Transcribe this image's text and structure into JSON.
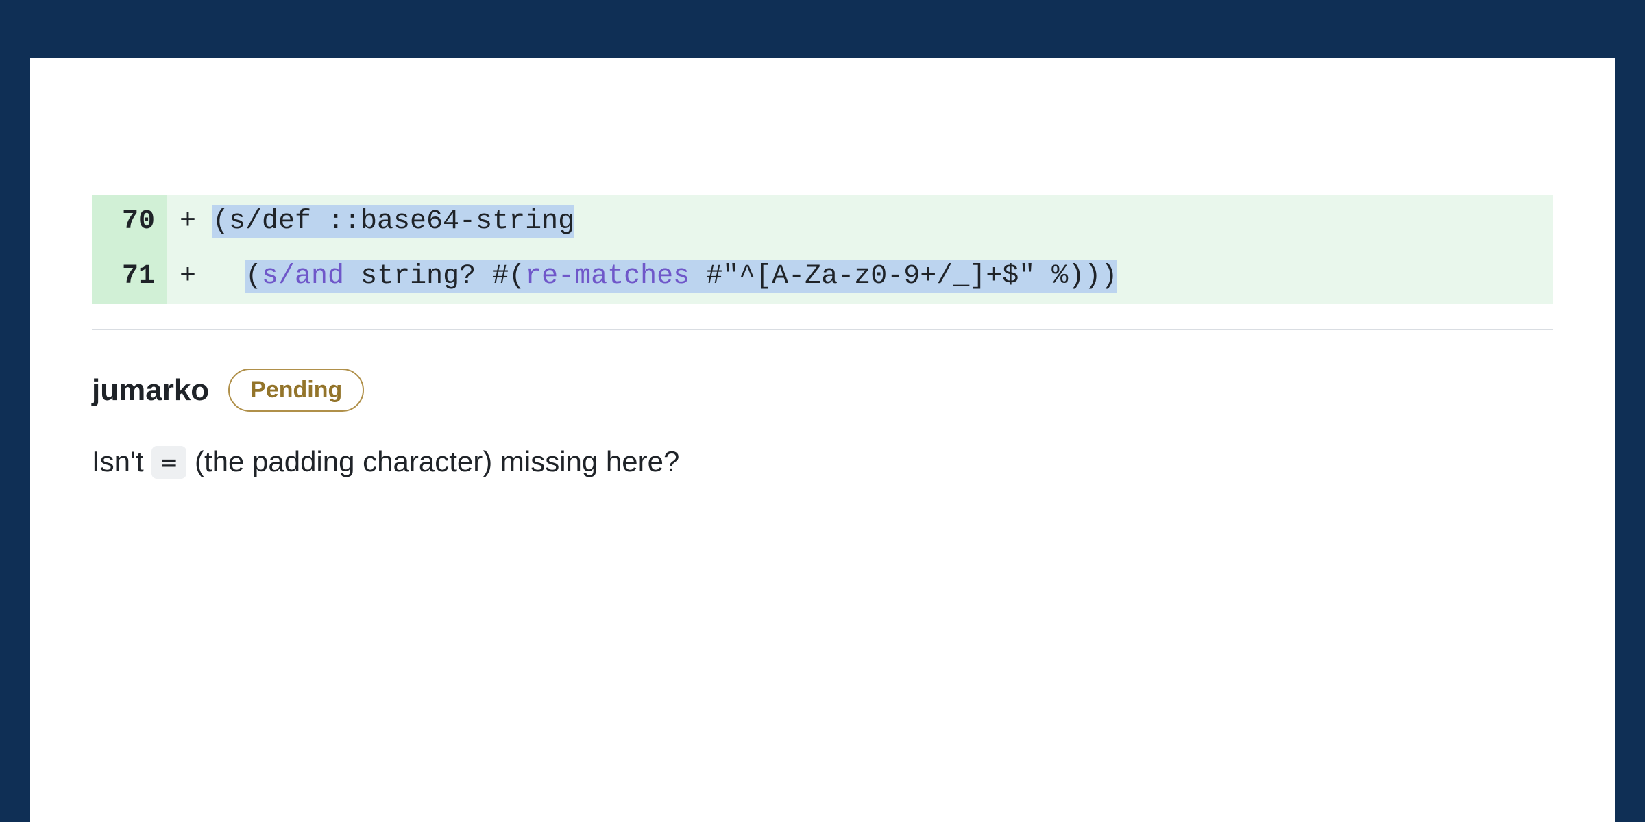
{
  "diff": {
    "rows": [
      {
        "lineno": "70",
        "sign": "+",
        "plain_prefix": "",
        "sel_pre": "(s/def ::base64-string",
        "fn": "",
        "sel_post": "",
        "trail_unsel": ""
      },
      {
        "lineno": "71",
        "sign": "+",
        "plain_prefix": "  ",
        "sel_pre": "(",
        "fn": "s/and",
        "sel_mid": " string? #(",
        "fn2": "re-matches",
        "sel_post": " #\"^[A-Za-z0-9+/_]+$\" %)))",
        "trail_unsel": ""
      }
    ]
  },
  "comment": {
    "author": "jumarko",
    "badge": "Pending",
    "body_pre": "Isn't ",
    "code": "=",
    "body_post": " (the padding character) missing here?"
  }
}
